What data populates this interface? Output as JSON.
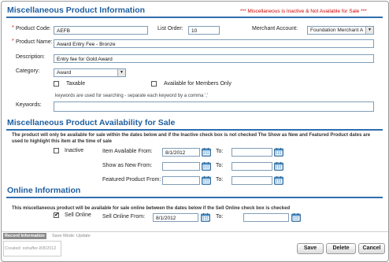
{
  "section1": {
    "title": "Miscellaneous Product Information",
    "alert": "*** Miscellaneous is Inactive & Not Available for Sale ***"
  },
  "form": {
    "product_code_label": "Product Code:",
    "product_code_value": "AEFB",
    "list_order_label": "List Order:",
    "list_order_value": "10",
    "merchant_account_label": "Merchant Account:",
    "merchant_account_value": "Foundation Merchant A",
    "product_name_label": "Product Name:",
    "product_name_value": "Award Entry Fee - Bronze",
    "description_label": "Description:",
    "description_value": "Entry fee for Gold Award",
    "category_label": "Category:",
    "category_value": "Award",
    "taxable_label": "Taxable",
    "members_only_label": "Available for Members Only",
    "keywords_hint": "keywords are used for searching - separate each keyword by a comma ','",
    "keywords_label": "Keywords:",
    "keywords_value": ""
  },
  "section2": {
    "title": "Miscellaneous Product Availability for Sale",
    "description": "The product will only be available for sale within the dates below and if the Inactive check box is not checked The Show as New and Featured Product dates are used to highlight this item at the time of sale",
    "inactive_label": "Inactive",
    "item_available_from_label": "Item Available From:",
    "item_available_from_value": "8/1/2012",
    "show_as_new_from_label": "Show as New From:",
    "show_as_new_from_value": "",
    "featured_product_from_label": "Featured Product From:",
    "featured_product_from_value": "",
    "to_label": "To:"
  },
  "section3": {
    "title": "Online Information",
    "description": "This miscellaneous product will be available for sale online between the dates below if the Sell Online check box is checked",
    "sell_online_label": "Sell Online",
    "sell_online_checked": true,
    "sell_online_from_label": "Sell Online From:",
    "sell_online_from_value": "8/1/2012",
    "to_label": "To:"
  },
  "footer": {
    "record_info_label": "Record Information",
    "save_mode_label": "Save Mode:",
    "save_mode_value": "Update",
    "created_text": "Created: sshaffer-8/8/2012",
    "save_label": "Save",
    "delete_label": "Delete",
    "cancel_label": "Cancel"
  },
  "icons": {
    "calendar": "calendar-icon",
    "dropdown": "chevron-down-icon",
    "check": "check-icon"
  },
  "colors": {
    "section_title": "#1f5f9f",
    "alert_red": "#d40000",
    "section_rule": "#2e6fb0"
  }
}
